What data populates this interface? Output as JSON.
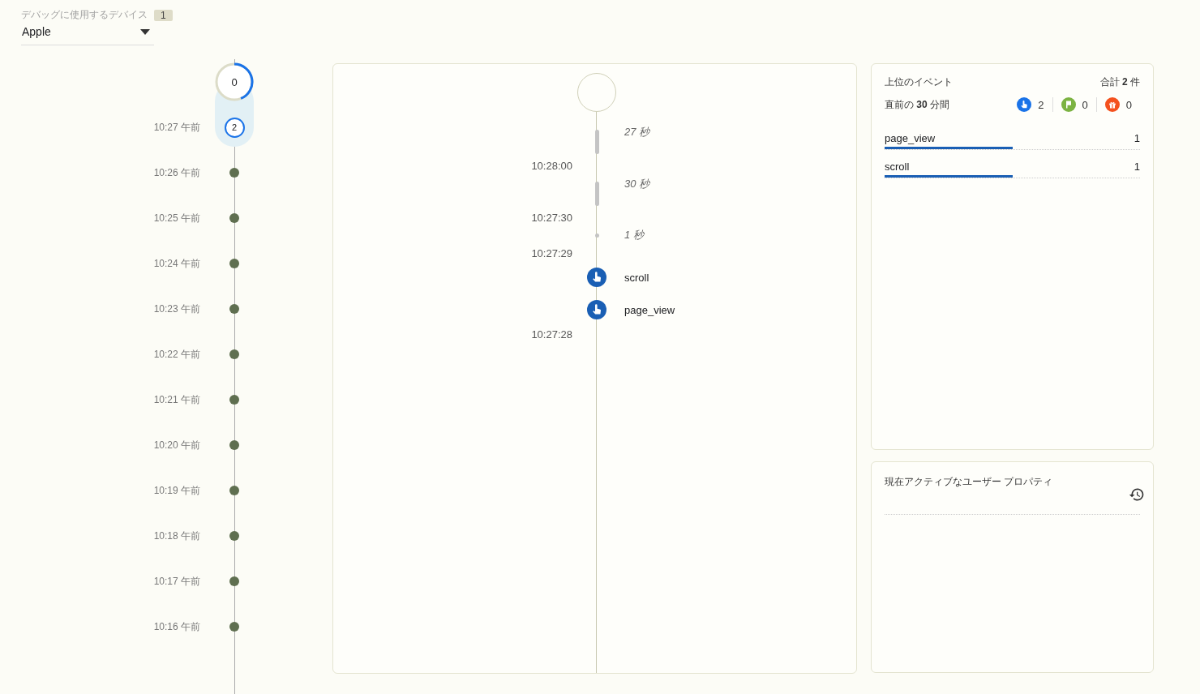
{
  "device_selector": {
    "label": "デバッグに使用するデバイス",
    "device_count": "1",
    "value": "Apple"
  },
  "minute_timeline": {
    "current": {
      "count": "0",
      "level": 0.44
    },
    "minutes": [
      {
        "time": "10:27 午前",
        "count": "2",
        "selected": true
      },
      {
        "time": "10:26 午前",
        "selected": false
      },
      {
        "time": "10:25 午前",
        "selected": false
      },
      {
        "time": "10:24 午前",
        "selected": false
      },
      {
        "time": "10:23 午前",
        "selected": false
      },
      {
        "time": "10:22 午前",
        "selected": false
      },
      {
        "time": "10:21 午前",
        "selected": false
      },
      {
        "time": "10:20 午前",
        "selected": false
      },
      {
        "time": "10:19 午前",
        "selected": false
      },
      {
        "time": "10:18 午前",
        "selected": false
      },
      {
        "time": "10:17 午前",
        "selected": false
      },
      {
        "time": "10:16 午前",
        "selected": false
      }
    ]
  },
  "seconds_timeline": {
    "items": [
      {
        "kind": "gap",
        "label": "27 秒"
      },
      {
        "kind": "time",
        "label": "10:28:00"
      },
      {
        "kind": "gap",
        "label": "30 秒"
      },
      {
        "kind": "time",
        "label": "10:27:30"
      },
      {
        "kind": "brief_gap",
        "label": "1 秒"
      },
      {
        "kind": "time",
        "label": "10:27:29"
      },
      {
        "kind": "event",
        "label": "scroll"
      },
      {
        "kind": "event",
        "label": "page_view"
      },
      {
        "kind": "time",
        "label": "10:27:28"
      }
    ]
  },
  "top_events": {
    "title": "上位のイベント",
    "total": "合計 **2** 件",
    "period": "直前の **30** 分間",
    "type_counts": [
      {
        "kind": "event",
        "color": "#1a73e8",
        "count": "2"
      },
      {
        "kind": "conversion",
        "color": "#7cb342",
        "count": "0"
      },
      {
        "kind": "error",
        "color": "#f4511e",
        "count": "0"
      }
    ],
    "events": [
      {
        "name": "page_view",
        "count": "1",
        "level": 0.5
      },
      {
        "name": "scroll",
        "count": "1",
        "level": 0.5
      }
    ]
  },
  "user_properties": {
    "title": "現在アクティブなユーザー プロパティ"
  }
}
